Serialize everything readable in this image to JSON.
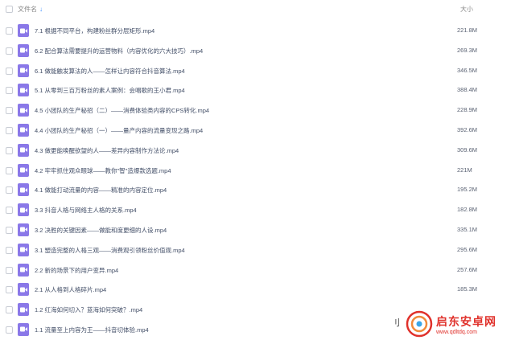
{
  "header": {
    "name_label": "文件名",
    "sort_arrow": "↓",
    "size_label": "大小"
  },
  "files": [
    {
      "name": "7.1 根据不同平台，构建粉丝群分层矩形.mp4",
      "size": "221.8M"
    },
    {
      "name": "6.2 配合算法需要提升的运营物料（内容优化的六大技巧）.mp4",
      "size": "269.3M"
    },
    {
      "name": "6.1 做能触发算法的人——怎样让内容符合抖音算法.mp4",
      "size": "346.5M"
    },
    {
      "name": "5.1 从零到三百万粉丝的素人案例：会唱歌的王小君.mp4",
      "size": "388.4M"
    },
    {
      "name": "4.5 小团队的生产秘招（二）——消费体验类内容的CPS转化.mp4",
      "size": "228.9M"
    },
    {
      "name": "4.4 小团队的生产秘招（一）——量产内容的流量变现之路.mp4",
      "size": "392.6M"
    },
    {
      "name": "4.3 做更能唤醒欲望的人——差异内容制作方法论.mp4",
      "size": "309.6M"
    },
    {
      "name": "4.2 牢牢抓住观众眼球——教你\"智\"造爆款选题.mp4",
      "size": "221M"
    },
    {
      "name": "4.1 做能打动流量的内容——精准的内容定位.mp4",
      "size": "195.2M"
    },
    {
      "name": "3.3 抖音人格与网络主人格的关系.mp4",
      "size": "182.8M"
    },
    {
      "name": "3.2 决胜的关键因素——做能和度更细的人设.mp4",
      "size": "335.1M"
    },
    {
      "name": "3.1 塑造完整的人格三观——消费观引领粉丝价值观.mp4",
      "size": "295.6M"
    },
    {
      "name": "2.2 新的场景下的用户变异.mp4",
      "size": "257.6M"
    },
    {
      "name": "2.1 从人格到人格碎片.mp4",
      "size": "185.3M"
    },
    {
      "name": "1.2 红海如何切入？蓝海如何突破？.mp4",
      "size": ""
    },
    {
      "name": "1.1 流量至上内容为王——抖音切体验.mp4",
      "size": ""
    }
  ],
  "watermark": {
    "mark": "刂",
    "title": "启东安卓网",
    "url": "www.qdltdq.com"
  },
  "colors": {
    "video_icon": "#8a78e8",
    "sort_arrow": "#3b8cff",
    "watermark_red": "#e0312b"
  }
}
